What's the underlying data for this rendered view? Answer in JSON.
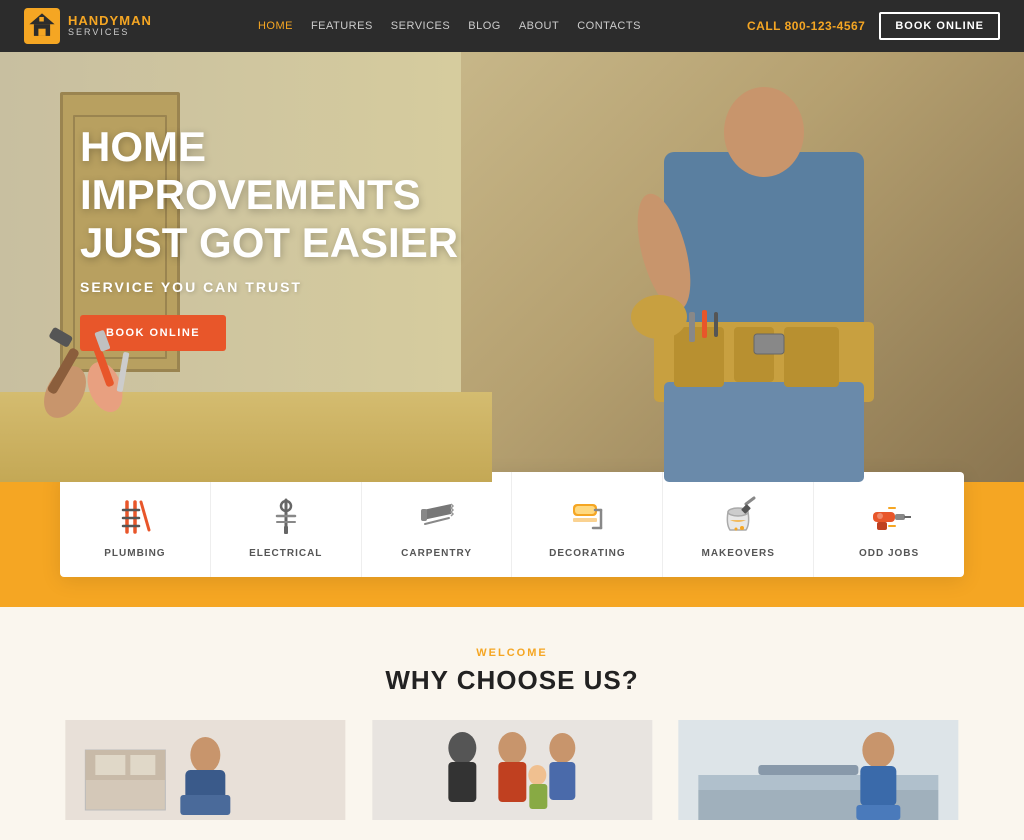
{
  "navbar": {
    "logo_handyman": "HANDY",
    "logo_man": "MAN",
    "logo_services": "SERVICES",
    "nav_items": [
      {
        "label": "HOME",
        "active": true
      },
      {
        "label": "FEATURES",
        "active": false
      },
      {
        "label": "SERVICES",
        "active": false
      },
      {
        "label": "BLOG",
        "active": false
      },
      {
        "label": "ABOUT",
        "active": false
      },
      {
        "label": "CONTACTS",
        "active": false
      }
    ],
    "call_label": "CALL",
    "phone": "800-123-4567",
    "book_btn": "BOOK ONLINE"
  },
  "hero": {
    "title_line1": "HOME IMPROVEMENTS",
    "title_line2": "JUST GOT EASIER",
    "subtitle": "SERVICE YOU CAN TRUST",
    "book_btn": "BOOK ONLINE"
  },
  "services": [
    {
      "id": "plumbing",
      "label": "PLUMBING"
    },
    {
      "id": "electrical",
      "label": "ELECTRICAL"
    },
    {
      "id": "carpentry",
      "label": "CARPENTRY"
    },
    {
      "id": "decorating",
      "label": "DECORATING"
    },
    {
      "id": "makeovers",
      "label": "MAKEOVERS"
    },
    {
      "id": "odd-jobs",
      "label": "ODD JOBS"
    }
  ],
  "why_section": {
    "welcome_label": "Welcome",
    "title": "WHY CHOOSE US?"
  }
}
